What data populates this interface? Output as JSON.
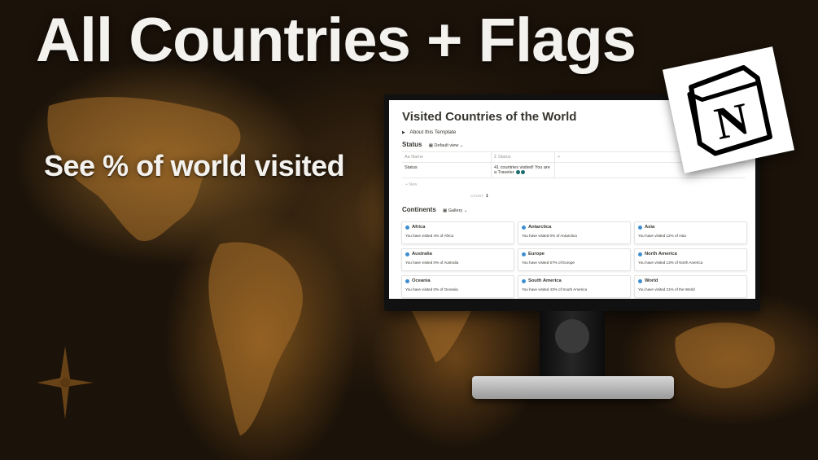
{
  "banner": {
    "headline": "All Countries + Flags",
    "subline": "See % of world visited"
  },
  "notion": {
    "page_title": "Visited Countries of the World",
    "about_label": "About this Template",
    "status_section": {
      "heading": "Status",
      "view_label": "Default view",
      "columns": [
        "Name",
        "Status",
        "+"
      ],
      "rows": [
        {
          "name": "Status",
          "value": "41 countries visited! You are a Traveler"
        }
      ],
      "new_label": "New",
      "count_label": "COUNT",
      "count_value": "1"
    },
    "continents_section": {
      "heading": "Continents",
      "view_label": "Gallery",
      "cards": [
        {
          "title": "Africa",
          "text": "You have visited 4% of Africa"
        },
        {
          "title": "Antarctica",
          "text": "You have visited 0% of Antarctica"
        },
        {
          "title": "Asia",
          "text": "You have visited 12% of Asia"
        },
        {
          "title": "Australia",
          "text": "You have visited 0% of Australia"
        },
        {
          "title": "Europe",
          "text": "You have visited 57% of Europe"
        },
        {
          "title": "North America",
          "text": "You have visited 13% of North America"
        },
        {
          "title": "Oceania",
          "text": "You have visited 0% of Oceania"
        },
        {
          "title": "South America",
          "text": "You have visited 42% of South America"
        },
        {
          "title": "World",
          "text": "You have visited 21% of the World"
        }
      ]
    }
  },
  "logo": {
    "letter": "N"
  },
  "colors": {
    "accent": "#1e6b6e",
    "map": "#a86f2a"
  }
}
